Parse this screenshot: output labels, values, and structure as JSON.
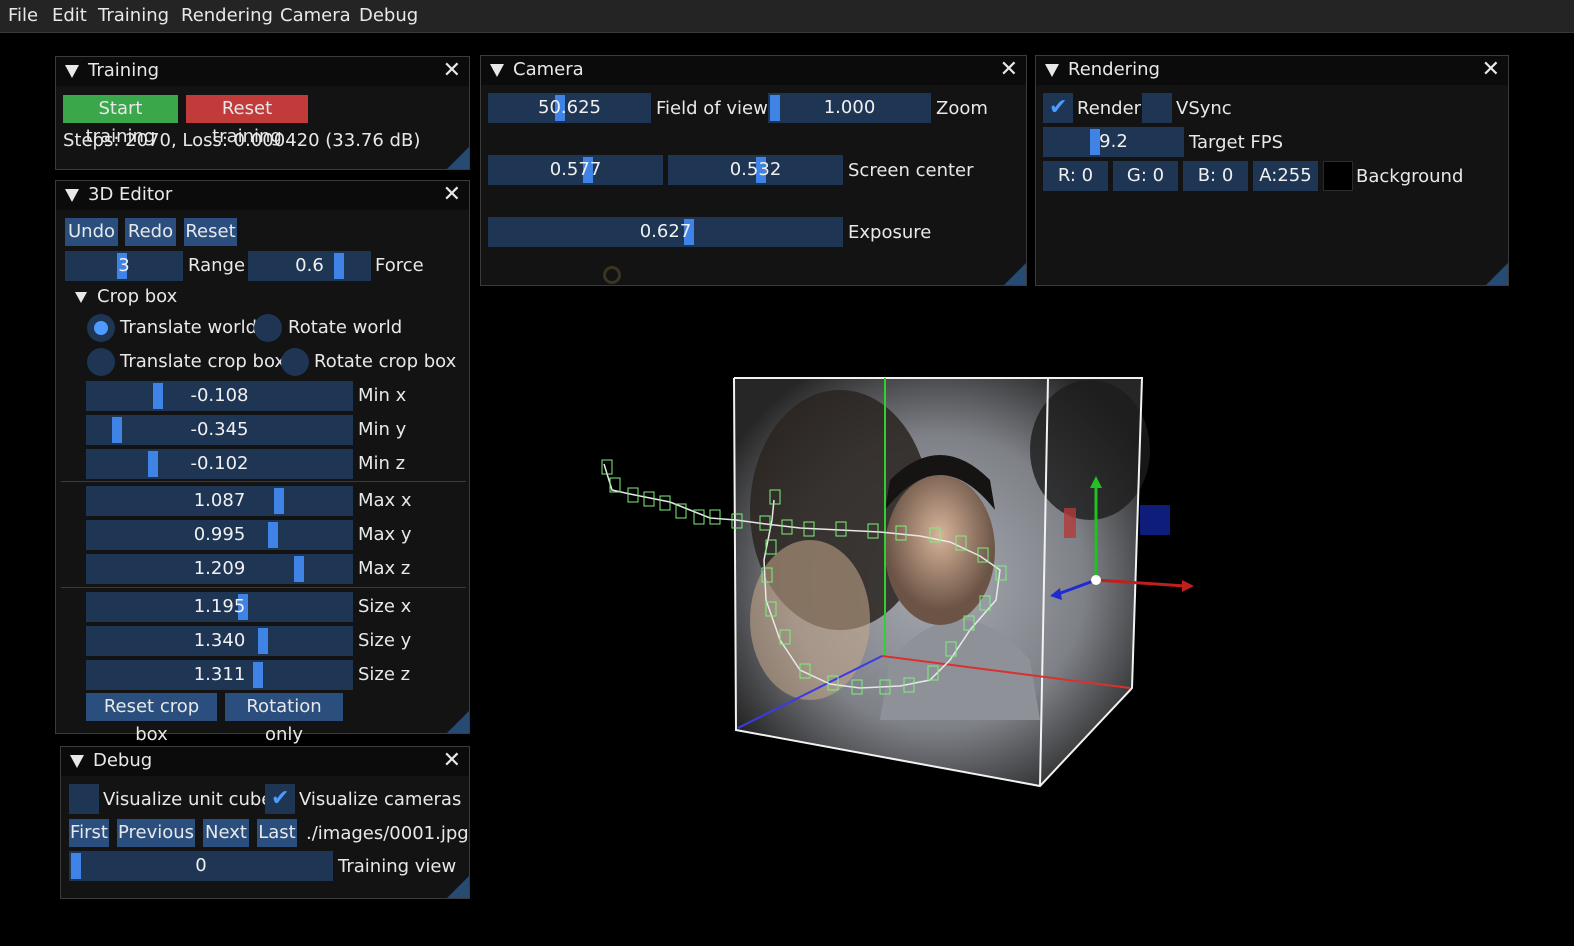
{
  "menu": [
    "File",
    "Edit",
    "Training",
    "Rendering",
    "Camera",
    "Debug"
  ],
  "training": {
    "title": "Training",
    "start": "Start training",
    "reset": "Reset training",
    "status": "Steps: 2070, Loss: 0.000420 (33.76 dB)"
  },
  "editor": {
    "title": "3D Editor",
    "undo": "Undo",
    "redo": "Redo",
    "reset": "Reset",
    "range": {
      "value": "3",
      "label": "Range"
    },
    "force": {
      "value": "0.6",
      "label": "Force"
    },
    "cropbox_title": "Crop box",
    "radios": [
      {
        "label": "Translate world",
        "selected": true
      },
      {
        "label": "Rotate world",
        "selected": false
      },
      {
        "label": "Translate crop box",
        "selected": false
      },
      {
        "label": "Rotate crop box",
        "selected": false
      }
    ],
    "fields": [
      {
        "value": "-0.108",
        "label": "Min x",
        "frac": 0.26
      },
      {
        "value": "-0.345",
        "label": "Min y",
        "frac": 0.1
      },
      {
        "value": "-0.102",
        "label": "Min z",
        "frac": 0.24
      },
      {
        "value": "1.087",
        "label": "Max x",
        "frac": 0.73
      },
      {
        "value": "0.995",
        "label": "Max y",
        "frac": 0.71
      },
      {
        "value": "1.209",
        "label": "Max z",
        "frac": 0.81
      },
      {
        "value": "1.195",
        "label": "Size x",
        "frac": 0.59
      },
      {
        "value": "1.340",
        "label": "Size y",
        "frac": 0.67
      },
      {
        "value": "1.311",
        "label": "Size z",
        "frac": 0.65
      }
    ],
    "reset_crop": "Reset crop box",
    "rotation_only": "Rotation only"
  },
  "debug": {
    "title": "Debug",
    "vis_unit_cube": {
      "label": "Visualize unit cube",
      "checked": false
    },
    "vis_cameras": {
      "label": "Visualize cameras",
      "checked": true
    },
    "first": "First",
    "previous": "Previous",
    "next": "Next",
    "last": "Last",
    "image_path": "./images/0001.jpg",
    "training_view": {
      "value": "0",
      "label": "Training view"
    }
  },
  "camera": {
    "title": "Camera",
    "fov": {
      "value": "50.625",
      "label": "Field of view"
    },
    "zoom": {
      "value": "1.000",
      "label": "Zoom"
    },
    "center_x": "0.577",
    "center_y": "0.532",
    "center_label": "Screen center",
    "exposure": {
      "value": "0.627",
      "label": "Exposure"
    }
  },
  "rendering": {
    "title": "Rendering",
    "render": {
      "label": "Render",
      "checked": true
    },
    "vsync": {
      "label": "VSync",
      "checked": false
    },
    "fps": {
      "value": "9.2",
      "label": "Target FPS"
    },
    "r": "R:  0",
    "g": "G:  0",
    "b": "B:  0",
    "a": "A:255",
    "background_label": "Background"
  },
  "colors": {
    "accent": "#3f83e6",
    "frame": "#1e3554",
    "button": "#2a4f7e",
    "start": "#3aa84a",
    "reset": "#c23b3b"
  }
}
